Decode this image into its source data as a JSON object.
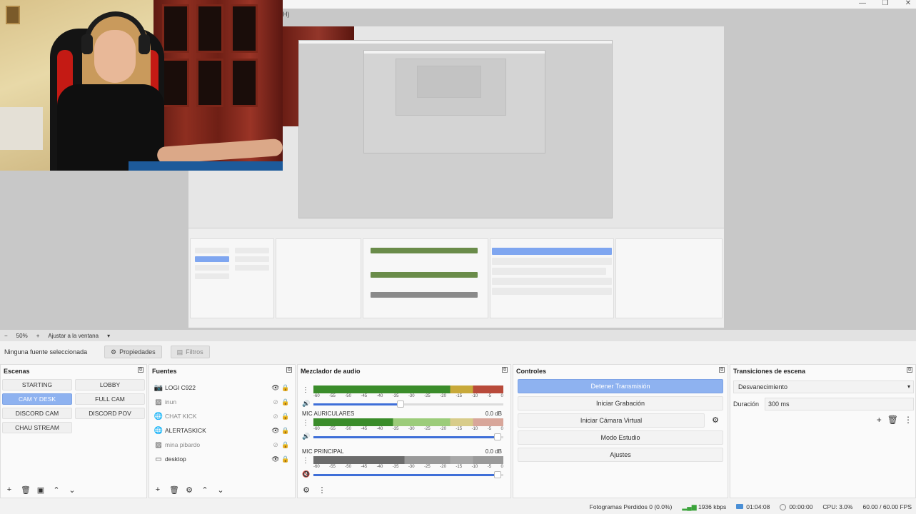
{
  "window": {
    "menu_fragment": "H)",
    "min": "—",
    "max": "❐",
    "close": "✕"
  },
  "preview": {
    "zoom": "50%",
    "zoom_minus": "−",
    "zoom_plus": "+",
    "fit": "Ajustar a la ventana",
    "fit_arrow": "▾"
  },
  "sourcebar": {
    "no_source": "Ninguna fuente seleccionada",
    "properties": "Propiedades",
    "filters": "Filtros"
  },
  "scenes": {
    "title": "Escenas",
    "items": [
      {
        "label": "STARTING",
        "active": false
      },
      {
        "label": "LOBBY",
        "active": false
      },
      {
        "label": "CAM Y DESK",
        "active": true
      },
      {
        "label": "FULL CAM",
        "active": false
      },
      {
        "label": "DISCORD CAM",
        "active": false
      },
      {
        "label": "DISCORD POV",
        "active": false
      },
      {
        "label": "CHAU STREAM",
        "active": false
      }
    ]
  },
  "sources": {
    "title": "Fuentes",
    "items": [
      {
        "label": "LOGI C922",
        "icon": "camera-icon",
        "visible": true
      },
      {
        "label": "inun",
        "icon": "image-icon",
        "visible": false
      },
      {
        "label": "CHAT KICK",
        "icon": "browser-icon",
        "visible": false
      },
      {
        "label": "ALERTASKICK",
        "icon": "browser-icon",
        "visible": true
      },
      {
        "label": "mina pibardo",
        "icon": "image-icon",
        "visible": false
      },
      {
        "label": "desktop",
        "icon": "monitor-icon",
        "visible": true
      }
    ]
  },
  "mixer": {
    "title": "Mezclador de audio",
    "ticks": [
      "-60",
      "-55",
      "-50",
      "-45",
      "-40",
      "-35",
      "-30",
      "-25",
      "-20",
      "-15",
      "-10",
      "-5",
      "0"
    ],
    "tracks": [
      {
        "name": "",
        "db": "",
        "level": 0.78,
        "muted": false
      },
      {
        "name": "MIC AURICULARES",
        "db": "0.0 dB",
        "level": 1.0,
        "muted": false
      },
      {
        "name": "MIC PRINCIPAL",
        "db": "0.0 dB",
        "level": 1.0,
        "muted": true
      }
    ]
  },
  "controls": {
    "title": "Controles",
    "stop_stream": "Detener Transmisión",
    "start_recording": "Iniciar Grabación",
    "start_virtual_cam": "Iniciar Cámara Virtual",
    "studio_mode": "Modo Estudio",
    "settings": "Ajustes"
  },
  "transitions": {
    "title": "Transiciones de escena",
    "selected": "Desvanecimiento",
    "duration_label": "Duración",
    "duration_value": "300 ms"
  },
  "status": {
    "dropped": "Fotogramas Perdidos 0 (0.0%)",
    "bitrate": "1936 kbps",
    "live_time": "01:04:08",
    "rec_time": "00:00:00",
    "cpu": "CPU: 3.0%",
    "fps": "60.00 / 60.00 FPS"
  }
}
